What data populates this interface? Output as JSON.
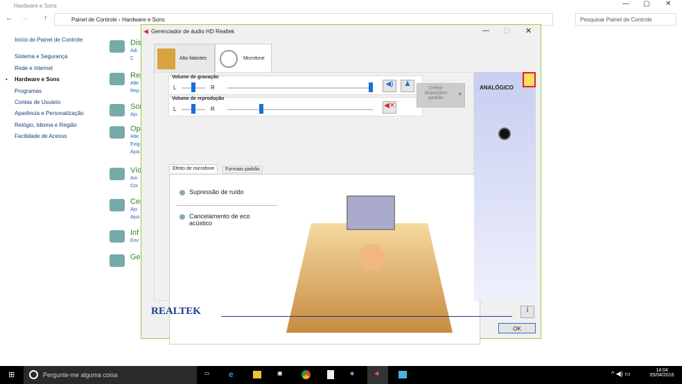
{
  "window": {
    "title": "Hardware e Sons",
    "breadcrumb": [
      "Painel de Controle",
      "Hardware e Sons"
    ],
    "search_placeholder": "Pesquisar Painel de Controle"
  },
  "sidebar": {
    "items": [
      "Início do Painel de Controle",
      "Sistema e Segurança",
      "Rede e Internet",
      "Hardware e Sons",
      "Programas",
      "Contas de Usuário",
      "Aparência e Personalização",
      "Relógio, Idioma e Região",
      "Facilidade de Acesso"
    ],
    "active": "Hardware e Sons"
  },
  "categories": [
    {
      "title": "Dis",
      "links": [
        "Adi",
        "C"
      ]
    },
    {
      "title": "Rep",
      "links": [
        "Alte",
        "Rep"
      ]
    },
    {
      "title": "Sor",
      "links": [
        "Aju"
      ]
    },
    {
      "title": "Op",
      "links": [
        "Alte",
        "Exig",
        "Ajus"
      ]
    },
    {
      "title": "Víd",
      "links": [
        "Am",
        "Cor"
      ]
    },
    {
      "title": "Cer",
      "links": [
        "Aju",
        "Ajus"
      ]
    },
    {
      "title": "Inf",
      "links": [
        "Env"
      ]
    },
    {
      "title": "Ge",
      "links": []
    }
  ],
  "dialog": {
    "title": "Gerenciador de áudio HD Realtek",
    "tabs": [
      "Alto-falantes",
      "Microfone"
    ],
    "active_tab": "Microfone",
    "recording": {
      "label": "Volume de gravação",
      "L": "L",
      "R": "R",
      "balance": 0.5,
      "level": 1.0
    },
    "playback": {
      "label": "Volume de reprodução",
      "L": "L",
      "R": "R",
      "balance": 0.5,
      "level": 0.25,
      "muted": true
    },
    "default_device": "Definir dispositivo padrão",
    "subtabs": [
      "Efeito de microfone",
      "Formato padrão"
    ],
    "options": [
      "Supressão de ruído",
      "Cancelamento de eco acústico"
    ],
    "right_label": "ANALÓGICO",
    "brand": "REALTEK",
    "ok": "OK",
    "info": "i"
  },
  "taskbar": {
    "search": "Pergunte-me alguma coisa",
    "time": "14:04",
    "date": "05/04/2016"
  },
  "colors": {
    "accent": "#1a6fd6",
    "link": "#2060c0",
    "category": "#2a8a2a",
    "highlight_box": "#e02020"
  }
}
